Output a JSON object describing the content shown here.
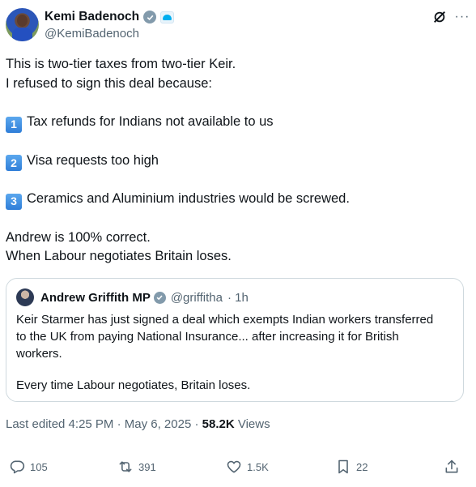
{
  "author": {
    "display_name": "Kemi Badenoch",
    "handle": "@KemiBadenoch"
  },
  "tweet": {
    "lines": [
      "This is two-tier taxes from two-tier Keir.",
      "I refused to sign this deal because:"
    ],
    "points": [
      {
        "number": "1",
        "text": "Tax refunds for Indians not available to us"
      },
      {
        "number": "2",
        "text": "Visa requests too high"
      },
      {
        "number": "3",
        "text": "Ceramics and Aluminium industries would be screwed."
      }
    ],
    "closing": [
      "Andrew is 100% correct.",
      "When Labour negotiates Britain loses."
    ]
  },
  "quote": {
    "display_name": "Andrew Griffith MP",
    "handle": "@griffitha",
    "time": "· 1h",
    "lines": [
      "Keir Starmer has just signed a deal which exempts Indian workers transferred",
      "to the UK from paying National Insurance... after increasing it for British",
      "workers."
    ],
    "closing": "Every time Labour negotiates, Britain loses."
  },
  "meta": {
    "edited": "Last edited 4:25 PM · May 6, 2025 ·",
    "views_count": "58.2K",
    "views_label": "Views"
  },
  "actions": {
    "replies": "105",
    "reposts": "391",
    "likes": "1.5K",
    "bookmarks": "22"
  },
  "colors": {
    "text": "#0f1419",
    "secondary": "#536471",
    "border": "#cfd9de",
    "verified_badge": "#829aab"
  },
  "icons": [
    "verified-badge-icon",
    "affiliation-badge-icon",
    "grok-icon",
    "more-icon",
    "reply-icon",
    "repost-icon",
    "like-icon",
    "bookmark-icon",
    "share-icon"
  ]
}
